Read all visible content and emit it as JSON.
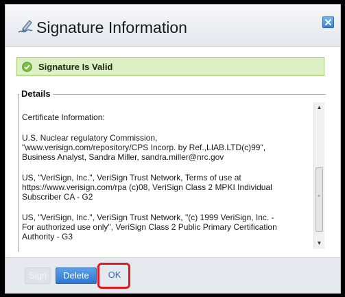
{
  "dialog": {
    "title": "Signature Information",
    "close_icon": "close-icon"
  },
  "status": {
    "icon": "check-circle-icon",
    "text": "Signature Is Valid",
    "color": "#dcefc5"
  },
  "details": {
    "legend": "Details",
    "heading": "Certificate Information:",
    "entries": [
      "U.S. Nuclear regulatory Commission,\n\"www.verisign.com/repository/CPS Incorp. by Ref.,LIAB.LTD(c)99\",\nBusiness Analyst, Sandra Miller, sandra.miller@nrc.gov",
      "US, \"VeriSign, Inc.\", VeriSign Trust Network, Terms of use at\nhttps://www.verisign.com/rpa (c)08, VeriSign Class 2 MPKI Individual\nSubscriber CA - G2",
      "US, \"VeriSign, Inc.\", VeriSign Trust Network, \"(c) 1999 VeriSign, Inc. -\nFor authorized use only\", VeriSign Class 2 Public Primary Certification\nAuthority - G3"
    ]
  },
  "footer": {
    "sign_label": "Sign",
    "delete_label": "Delete",
    "ok_label": "OK"
  },
  "colors": {
    "accent": "#2f78cf",
    "highlight": "#e0191f"
  }
}
